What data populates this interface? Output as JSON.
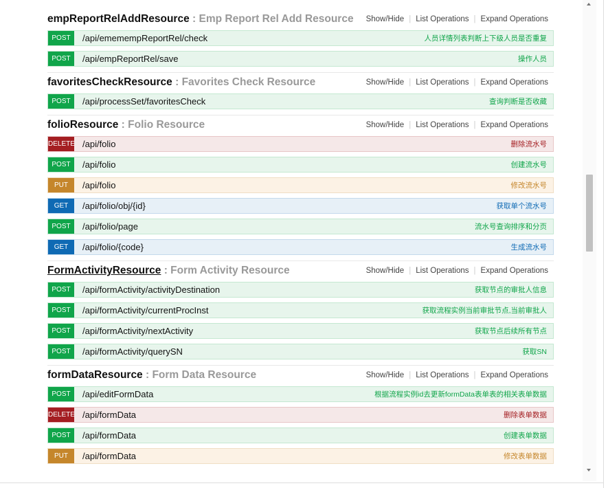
{
  "header_actions": {
    "show_hide": "Show/Hide",
    "list_operations": "List Operations",
    "expand_operations": "Expand Operations"
  },
  "resources": [
    {
      "name": "empReportRelAddResource",
      "separator": " : ",
      "description": "Emp Report Rel Add Resource",
      "operations": [
        {
          "method": "POST",
          "path": "/api/ememempReportRel/check",
          "summary": "人员详情列表判断上下级人员是否重复"
        },
        {
          "method": "POST",
          "path": "/api/empReportRel/save",
          "summary": "操作人员"
        }
      ]
    },
    {
      "name": "favoritesCheckResource",
      "separator": " : ",
      "description": "Favorites Check Resource",
      "operations": [
        {
          "method": "POST",
          "path": "/api/processSet/favoritesCheck",
          "summary": "查询判断是否收藏"
        }
      ]
    },
    {
      "name": "folioResource",
      "separator": " : ",
      "description": "Folio Resource",
      "operations": [
        {
          "method": "DELETE",
          "path": "/api/folio",
          "summary": "删除流水号"
        },
        {
          "method": "POST",
          "path": "/api/folio",
          "summary": "创建流水号"
        },
        {
          "method": "PUT",
          "path": "/api/folio",
          "summary": "修改流水号"
        },
        {
          "method": "GET",
          "path": "/api/folio/obj/{id}",
          "summary": "获取单个流水号"
        },
        {
          "method": "POST",
          "path": "/api/folio/page",
          "summary": "流水号查询排序和分页"
        },
        {
          "method": "GET",
          "path": "/api/folio/{code}",
          "summary": "生成流水号"
        }
      ]
    },
    {
      "name": "FormActivityResource",
      "separator": " : ",
      "description": "Form Activity Resource",
      "operations": [
        {
          "method": "POST",
          "path": "/api/formActivity/activityDestination",
          "summary": "获取节点的审批人信息"
        },
        {
          "method": "POST",
          "path": "/api/formActivity/currentProcInst",
          "summary": "获取流程实例当前审批节点,当前审批人"
        },
        {
          "method": "POST",
          "path": "/api/formActivity/nextActivity",
          "summary": "获取节点后续所有节点"
        },
        {
          "method": "POST",
          "path": "/api/formActivity/querySN",
          "summary": "获取SN"
        }
      ]
    },
    {
      "name": "formDataResource",
      "separator": " : ",
      "description": "Form Data Resource",
      "operations": [
        {
          "method": "POST",
          "path": "/api/editFormData",
          "summary": "根据流程实例id去更新formData表单表的相关表单数据"
        },
        {
          "method": "DELETE",
          "path": "/api/formData",
          "summary": "删除表单数据"
        },
        {
          "method": "POST",
          "path": "/api/formData",
          "summary": "创建表单数据"
        },
        {
          "method": "PUT",
          "path": "/api/formData",
          "summary": "修改表单数据"
        }
      ]
    }
  ],
  "colors": {
    "post": "#10a54a",
    "delete": "#a41e22",
    "put": "#c5862b",
    "get": "#0f6ab4"
  }
}
